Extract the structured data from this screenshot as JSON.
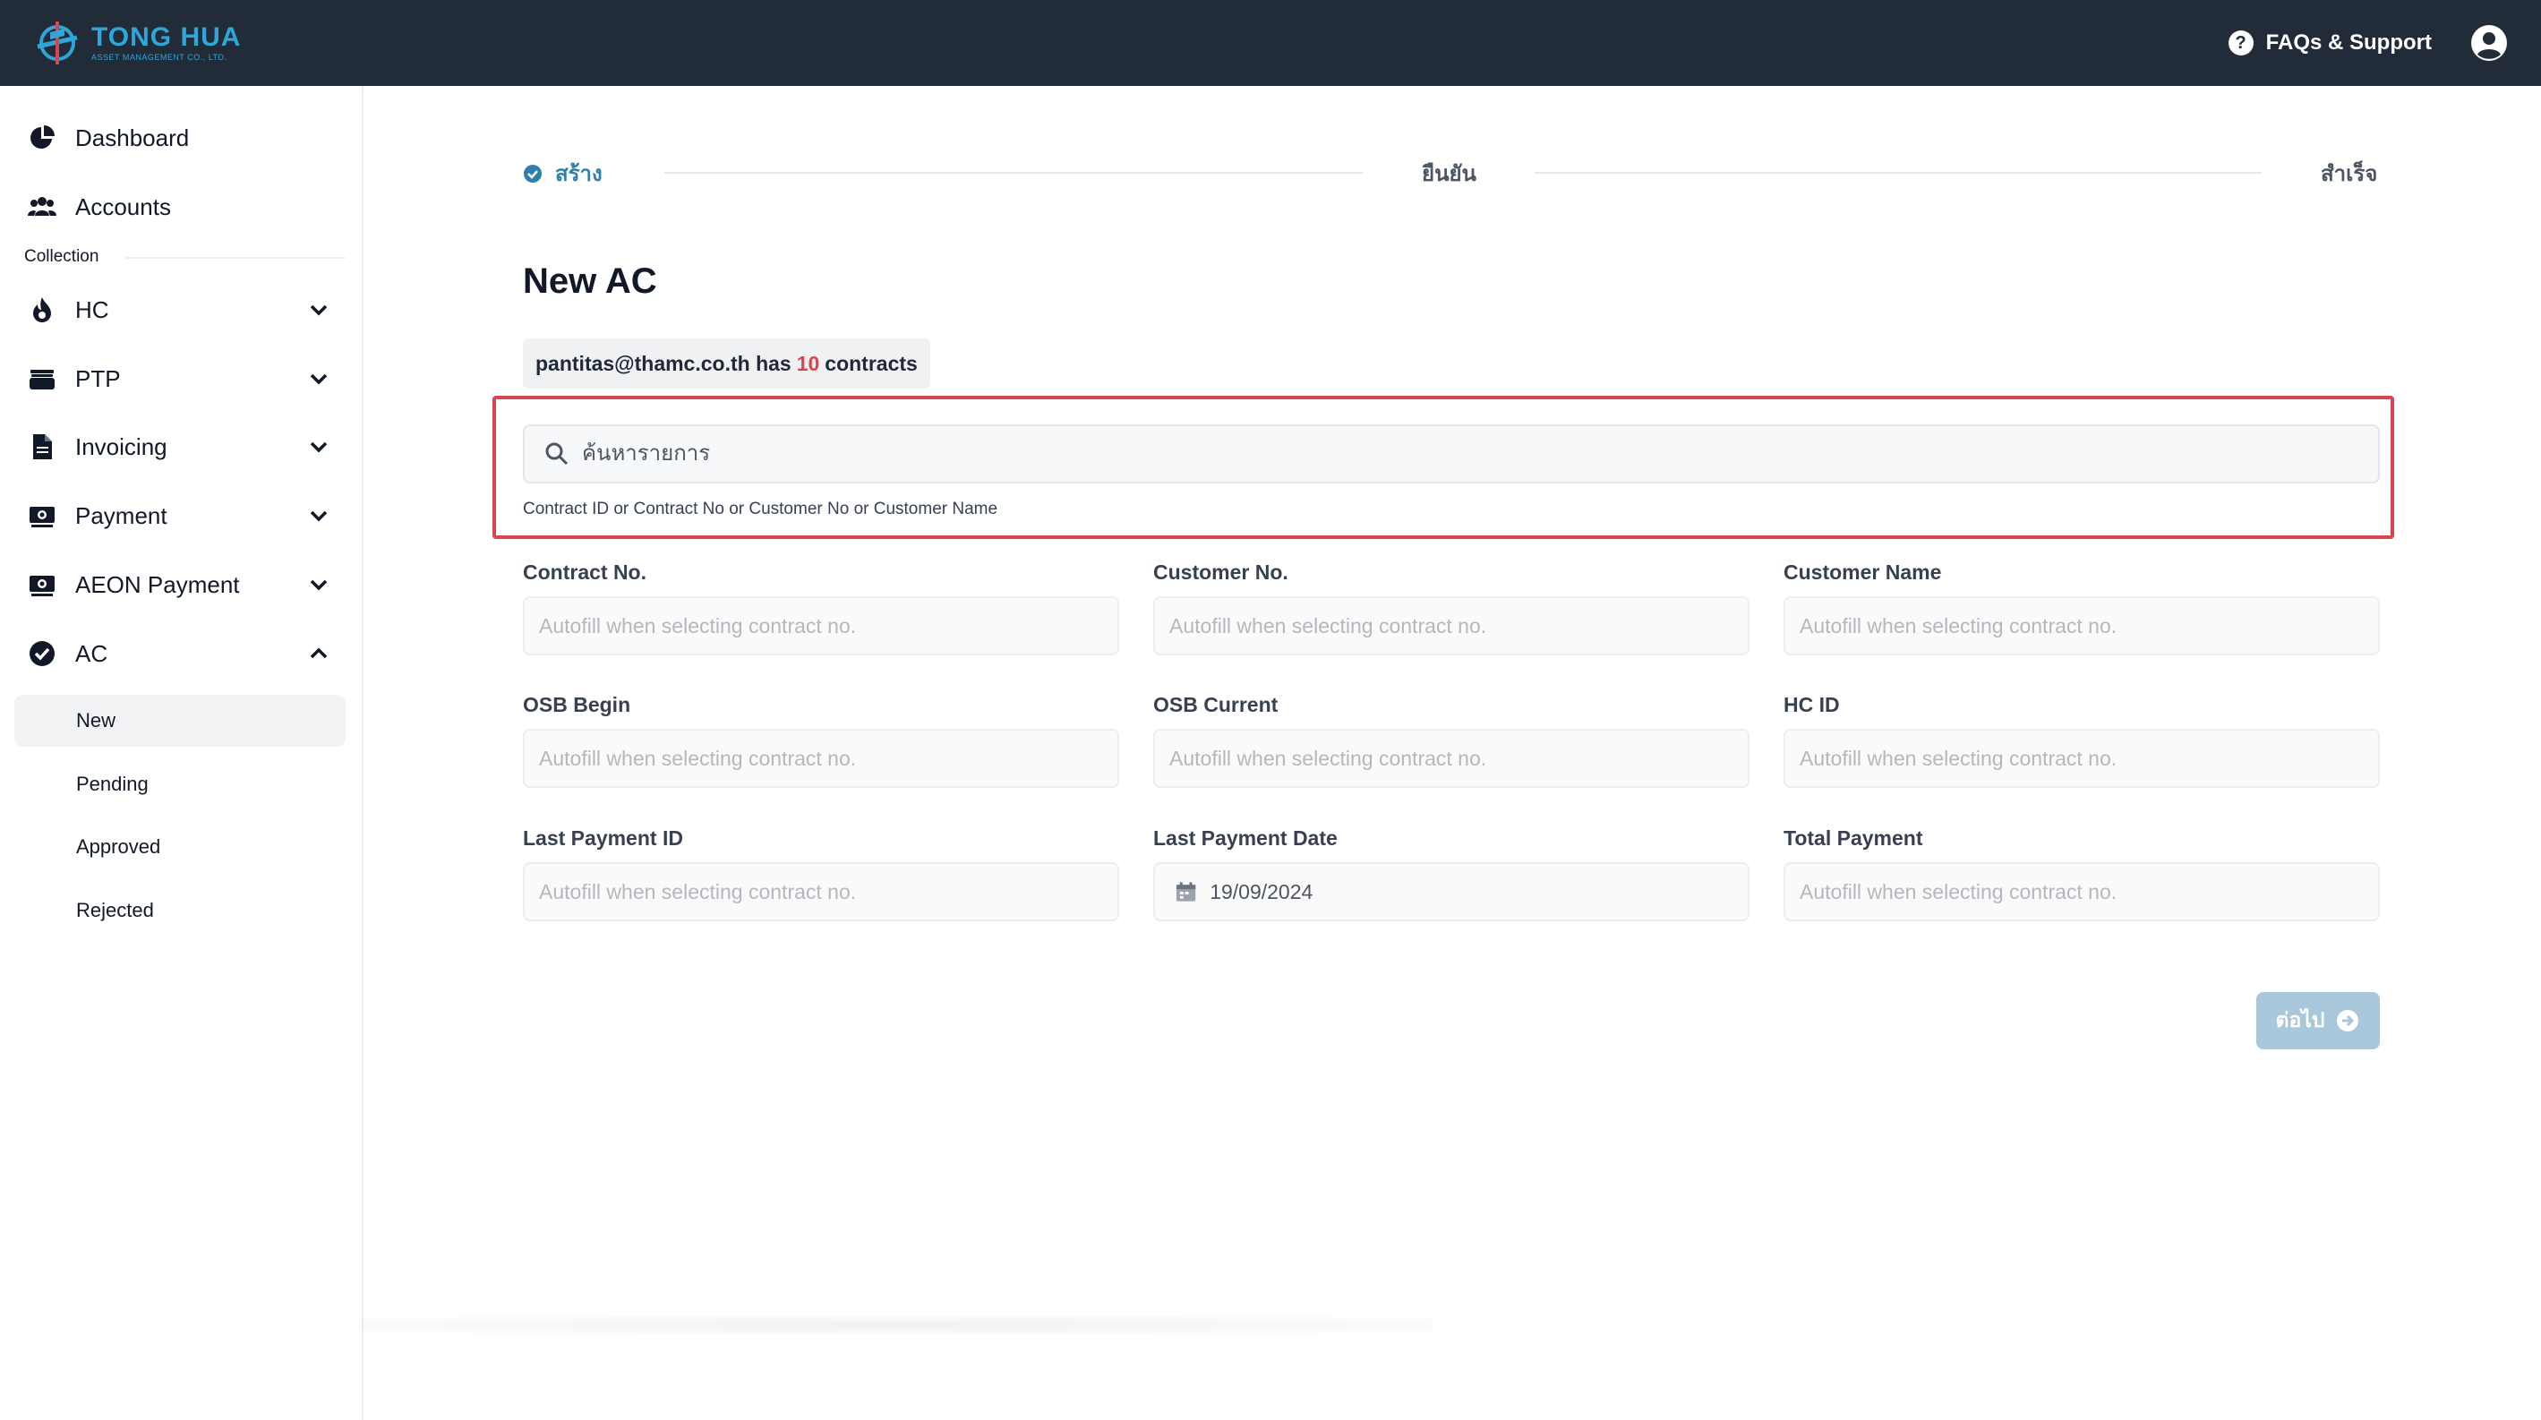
{
  "header": {
    "brand_name": "TONG HUA",
    "brand_sub": "ASSET MANAGEMENT CO., LTD.",
    "faq_label": "FAQs & Support"
  },
  "sidebar": {
    "items": [
      {
        "label": "Dashboard"
      },
      {
        "label": "Accounts"
      }
    ],
    "section_label": "Collection",
    "collection_items": [
      {
        "label": "HC"
      },
      {
        "label": "PTP"
      },
      {
        "label": "Invoicing"
      },
      {
        "label": "Payment"
      },
      {
        "label": "AEON Payment"
      },
      {
        "label": "AC"
      }
    ],
    "ac_sub_items": [
      {
        "label": "New"
      },
      {
        "label": "Pending"
      },
      {
        "label": "Approved"
      },
      {
        "label": "Rejected"
      }
    ]
  },
  "stepper": {
    "steps": [
      "สร้าง",
      "ยืนยัน",
      "สำเร็จ"
    ]
  },
  "main": {
    "title": "New AC",
    "contract_chip": {
      "email_prefix": "pantitas@thamc.co.th has",
      "count": "10",
      "suffix": "contracts"
    },
    "search": {
      "placeholder": "ค้นหารายการ",
      "hint": "Contract ID or Contract No or Customer No or Customer Name"
    },
    "fields": [
      {
        "label": "Contract No.",
        "placeholder": "Autofill when selecting contract no.",
        "value": ""
      },
      {
        "label": "Customer No.",
        "placeholder": "Autofill when selecting contract no.",
        "value": ""
      },
      {
        "label": "Customer Name",
        "placeholder": "Autofill when selecting contract no.",
        "value": ""
      },
      {
        "label": "OSB Begin",
        "placeholder": "Autofill when selecting contract no.",
        "value": ""
      },
      {
        "label": "OSB Current",
        "placeholder": "Autofill when selecting contract no.",
        "value": ""
      },
      {
        "label": "HC ID",
        "placeholder": "Autofill when selecting contract no.",
        "value": ""
      },
      {
        "label": "Last Payment ID",
        "placeholder": "Autofill when selecting contract no.",
        "value": ""
      },
      {
        "label": "Last Payment Date",
        "placeholder": "",
        "value": "19/09/2024"
      },
      {
        "label": "Total Payment",
        "placeholder": "Autofill when selecting contract no.",
        "value": ""
      }
    ],
    "next_label": "ต่อไป"
  },
  "colors": {
    "topbar": "#222b38",
    "accent": "#2e7fab",
    "highlight_border": "#d9454e",
    "count_red": "#e0424a",
    "next_button": "#a9c7da"
  }
}
